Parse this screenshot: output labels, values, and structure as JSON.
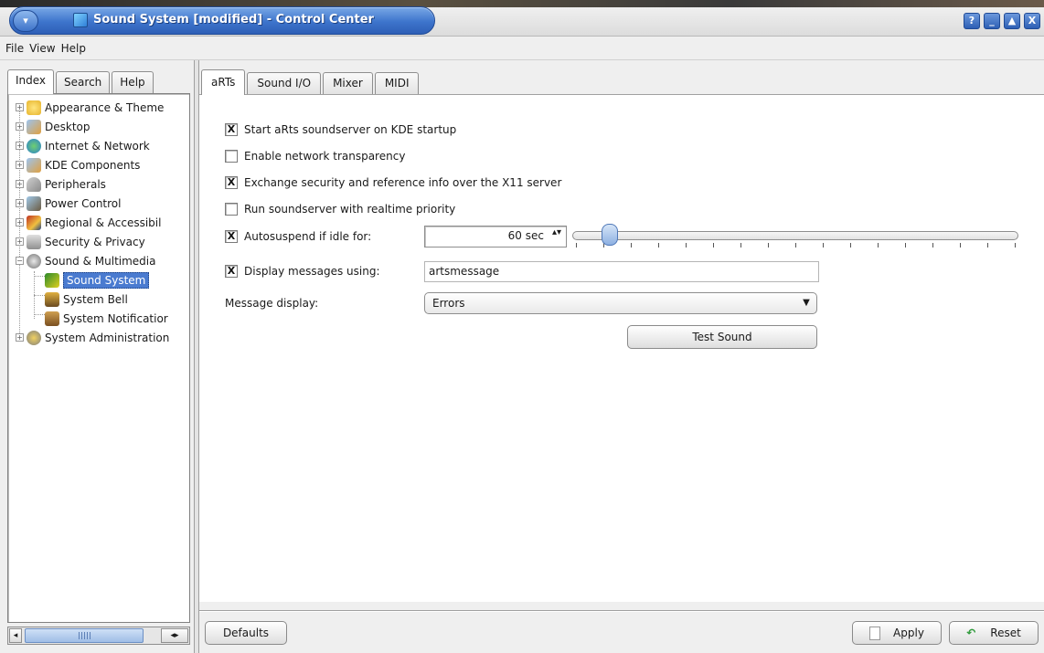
{
  "window": {
    "title": "Sound System [modified] - Control Center",
    "menu_button": "▾",
    "buttons": {
      "help": "?",
      "minimize": "_",
      "maximize": "▲",
      "close": "X"
    }
  },
  "menubar": {
    "file": "File",
    "view": "View",
    "help": "Help"
  },
  "left_tabs": {
    "index": "Index",
    "search": "Search",
    "help": "Help"
  },
  "tree": [
    {
      "label": "Appearance & Theme",
      "icon": "appearance-icon",
      "expander": "+"
    },
    {
      "label": "Desktop",
      "icon": "desktop-icon",
      "expander": "+"
    },
    {
      "label": "Internet & Network",
      "icon": "globe-icon",
      "expander": "+"
    },
    {
      "label": "KDE Components",
      "icon": "components-icon",
      "expander": "+"
    },
    {
      "label": "Peripherals",
      "icon": "mouse-icon",
      "expander": "+"
    },
    {
      "label": "Power Control",
      "icon": "power-icon",
      "expander": "+"
    },
    {
      "label": "Regional & Accessibil",
      "icon": "flag-icon",
      "expander": "+"
    },
    {
      "label": "Security & Privacy",
      "icon": "lock-icon",
      "expander": "+"
    },
    {
      "label": "Sound & Multimedia",
      "icon": "speaker-icon",
      "expander": "−"
    },
    {
      "label": "Sound System",
      "icon": "sound-system-icon",
      "expander": ""
    },
    {
      "label": "System Bell",
      "icon": "bell-icon",
      "expander": ""
    },
    {
      "label": "System Notificatior",
      "icon": "notification-icon",
      "expander": ""
    },
    {
      "label": "System Administration",
      "icon": "gears-icon",
      "expander": "+"
    }
  ],
  "hscroll": {
    "left": "◂",
    "right": "◂▸"
  },
  "right_tabs": {
    "arts": "aRTs",
    "sound_io": "Sound I/O",
    "mixer": "Mixer",
    "midi": "MIDI"
  },
  "options": {
    "start_arts": {
      "label": "Start aRts soundserver on KDE startup",
      "checked": "X"
    },
    "network_transparency": {
      "label": "Enable network transparency",
      "checked": ""
    },
    "exchange_security": {
      "label": "Exchange security and reference info over the X11 server",
      "checked": "X"
    },
    "realtime": {
      "label": "Run soundserver with realtime priority",
      "checked": ""
    },
    "autosuspend": {
      "label": "Autosuspend if idle for:",
      "checked": "X"
    },
    "display_messages": {
      "label": "Display messages using:",
      "checked": "X"
    },
    "message_display_label": "Message display:"
  },
  "autosuspend_value": "60 sec",
  "spin_arrows": "▴▾",
  "autosuspend_slider_fraction": 0.06,
  "messages_program": "artsmessage",
  "message_display_selected": "Errors",
  "combo_arrow": "▼",
  "buttons": {
    "test_sound": "Test Sound",
    "defaults": "Defaults",
    "apply": "Apply",
    "reset": "Reset"
  },
  "colors": {
    "titlebar_blue": "#3d74cc",
    "selection": "#4a7bd0"
  }
}
